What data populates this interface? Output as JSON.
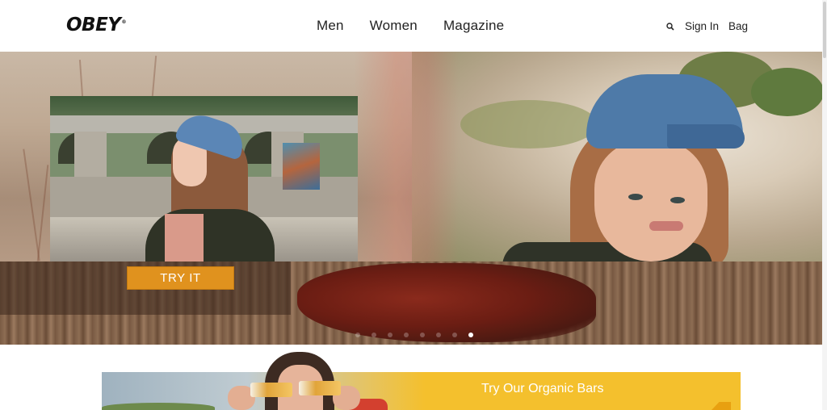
{
  "header": {
    "logo": "OBEY",
    "logo_mark": "®",
    "nav": [
      {
        "label": "Men"
      },
      {
        "label": "Women"
      },
      {
        "label": "Magazine"
      }
    ],
    "search_icon": "search-icon",
    "sign_in": "Sign In",
    "bag": "Bag"
  },
  "hero": {
    "cta_label": "TRY IT",
    "slides_count": 8,
    "active_slide": 8
  },
  "promo": {
    "text": "Try Our Organic Bars"
  },
  "colors": {
    "cta": "#e0921e",
    "promo_bg": "#f4c02d",
    "text": "#222222"
  }
}
